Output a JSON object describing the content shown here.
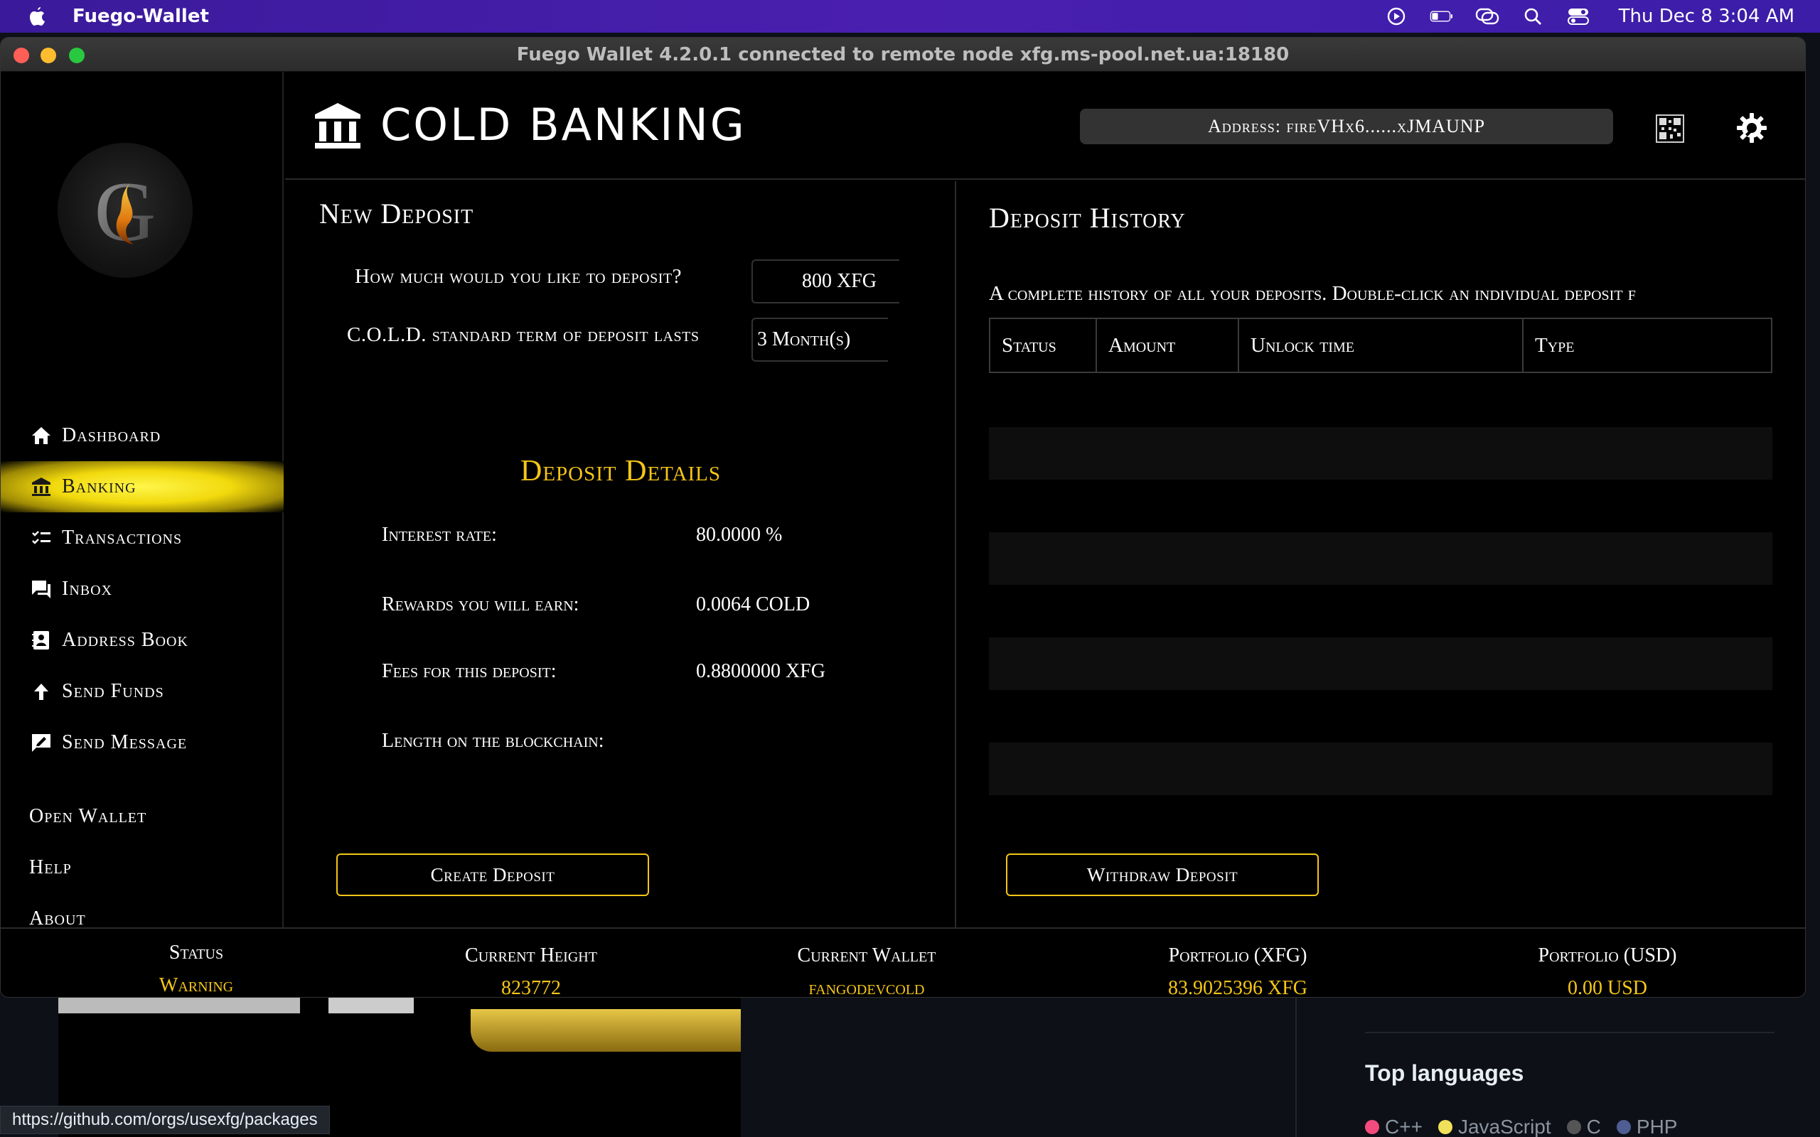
{
  "menubar": {
    "app_name": "Fuego-Wallet",
    "clock": "Thu Dec 8  3:04 AM"
  },
  "window": {
    "title": "Fuego Wallet 4.2.0.1 connected to remote node xfg.ms-pool.net.ua:18180"
  },
  "sidebar": {
    "items": [
      {
        "label": "Dashboard",
        "icon": "home-icon"
      },
      {
        "label": "Banking",
        "icon": "bank-icon",
        "active": true
      },
      {
        "label": "Transactions",
        "icon": "list-icon"
      },
      {
        "label": "Inbox",
        "icon": "chat-icon"
      },
      {
        "label": "Address Book",
        "icon": "contact-icon"
      },
      {
        "label": "Send Funds",
        "icon": "arrow-up-icon"
      },
      {
        "label": "Send Message",
        "icon": "message-icon"
      }
    ],
    "links": [
      "Open Wallet",
      "Help",
      "About"
    ]
  },
  "header": {
    "title": "COLD BANKING",
    "address": "Address: fireVHx6......xJMAUNP"
  },
  "new_deposit": {
    "title": "New Deposit",
    "amount_label": "How much would you like to deposit?",
    "amount_value": "800 XFG",
    "term_label": "C.O.L.D. standard term of deposit lasts",
    "term_value": "3 Month(s)",
    "details_title": "Deposit Details",
    "interest_label": "Interest rate:",
    "interest_value": "80.0000 %",
    "rewards_label": "Rewards you will earn:",
    "rewards_value": "0.0064 COLD",
    "fees_label": "Fees for this deposit:",
    "fees_value": "0.8800000 XFG",
    "length_label": "Length on the blockchain:",
    "create_button": "Create Deposit"
  },
  "deposit_history": {
    "title": "Deposit History",
    "description": "A complete history of all your deposits. Double-click an individual deposit f",
    "columns": [
      "Status",
      "Amount",
      "Unlock time",
      "Type"
    ],
    "withdraw_button": "Withdraw Deposit"
  },
  "footer": {
    "status_label": "Status",
    "status_value": "Warning",
    "height_label": "Current Height",
    "height_value": "823772",
    "wallet_label": "Current Wallet",
    "wallet_value": "fangodevcold",
    "portfolio_xfg_label": "Portfolio (XFG)",
    "portfolio_xfg_value": "83.9025396 XFG",
    "portfolio_usd_label": "Portfolio (USD)",
    "portfolio_usd_value": "0.00 USD"
  },
  "background": {
    "top_languages": "Top languages",
    "languages": [
      {
        "name": "C++",
        "color": "#f34b7d"
      },
      {
        "name": "JavaScript",
        "color": "#f1e05a"
      },
      {
        "name": "C",
        "color": "#555555"
      },
      {
        "name": "PHP",
        "color": "#4F5D95"
      }
    ],
    "status_url": "https://github.com/orgs/usexfg/packages"
  },
  "colors": {
    "accent_gold": "#f5c518",
    "window_bg": "#000000"
  }
}
